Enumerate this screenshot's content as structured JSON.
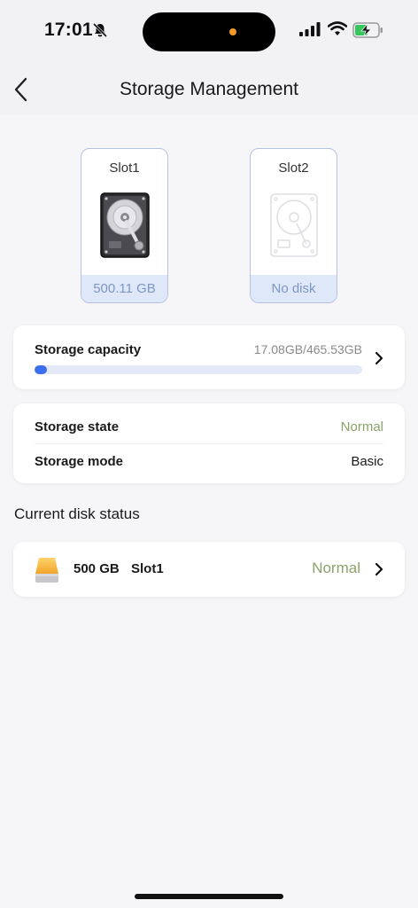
{
  "status_bar": {
    "time": "17:01"
  },
  "header": {
    "title": "Storage Management"
  },
  "slots": [
    {
      "name": "Slot1",
      "footer": "500.11 GB",
      "icon": "hard-disk-icon"
    },
    {
      "name": "Slot2",
      "footer": "No disk",
      "icon": "empty-disk-icon"
    }
  ],
  "capacity": {
    "label": "Storage capacity",
    "value": "17.08GB/465.53GB",
    "used_fraction": 0.037,
    "bar_color": "#3c6ef0"
  },
  "state": {
    "state_label": "Storage state",
    "state_value": "Normal",
    "mode_label": "Storage mode",
    "mode_value": "Basic",
    "normal_color": "#8ca26a"
  },
  "disk_status": {
    "section_title": "Current disk status",
    "size": "500 GB",
    "slot": "Slot1",
    "status": "Normal"
  }
}
